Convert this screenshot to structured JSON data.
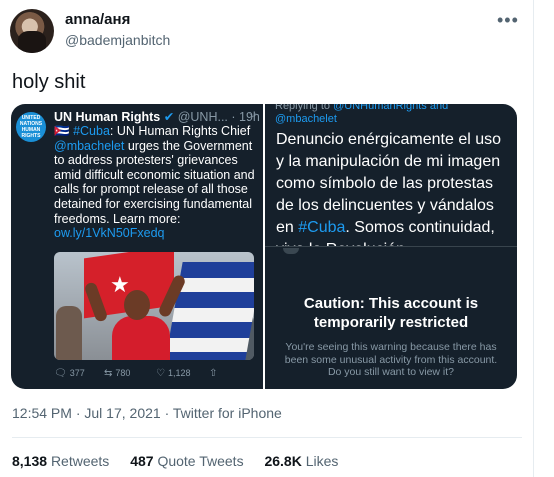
{
  "author": {
    "display_name": "anna/аня",
    "handle": "@bademjanbitch"
  },
  "tweet_text": "holy shit",
  "more_icon": "•••",
  "media": {
    "left": {
      "avatar_text": "UNITED NATIONS HUMAN RIGHTS",
      "account_name": "UN Human Rights",
      "verified_icon": "✔",
      "handle_time": "@UNH... · 19h",
      "flag_emoji": "🇨🇺",
      "hashtag": "#Cuba",
      "body_1": ": UN Human Rights Chief",
      "mention": "@mbachelet",
      "body_2": " urges the Government to address protesters' grievances amid difficult economic situation and calls for prompt release of all those detained for exercising fundamental freedoms. Learn more: ",
      "link": "ow.ly/1VkN50Fxedq",
      "actions": {
        "reply_count": "377",
        "retweet_count": "780",
        "like_count": "1,128"
      }
    },
    "right": {
      "replying_to_label": "Replying to ",
      "replying_to_mention": "@UNHumanRights and",
      "replying_to_mention2": "@mbachelet",
      "body_1": "Denuncio enérgicamente el uso y la manipulación de mi imagen  como símbolo de las protestas de los delincuentes y vándalos en ",
      "hashtag": "#Cuba",
      "body_2": ". Somos continuidad, viva la Revolución.",
      "caution_title": "Caution: This account is temporarily restricted",
      "caution_text": "You're seeing this warning because there has been some unusual activity from this account. Do you still want to view it?"
    }
  },
  "meta": {
    "time": "12:54 PM",
    "date": "Jul 17, 2021",
    "source": "Twitter for iPhone",
    "separator": " · "
  },
  "stats": {
    "retweets_count": "8,138",
    "retweets_label": "Retweets",
    "quotes_count": "487",
    "quotes_label": "Quote Tweets",
    "likes_count": "26.8K",
    "likes_label": "Likes"
  },
  "colors": {
    "link_blue": "#1d9bf0",
    "dim_bg": "#15202b",
    "muted": "#536471"
  }
}
